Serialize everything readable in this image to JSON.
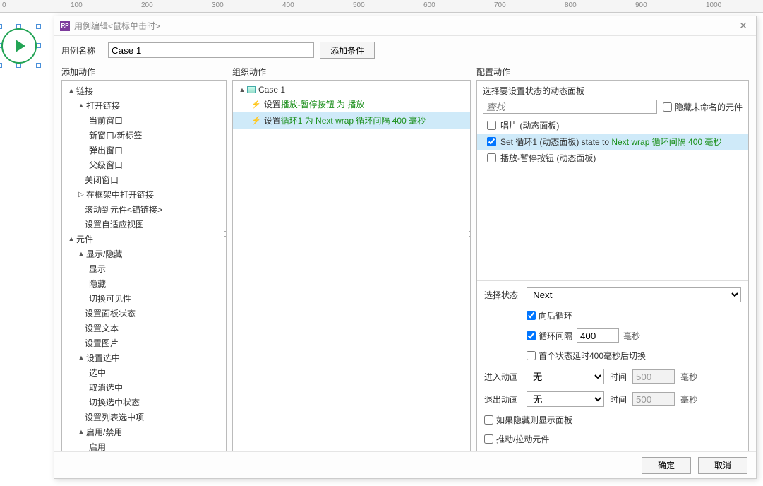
{
  "ruler": [
    "0",
    "100",
    "200",
    "300",
    "400",
    "500",
    "600",
    "700",
    "800",
    "900",
    "1000"
  ],
  "dialog": {
    "title": "用例编辑<鼠标单击时>",
    "icon_text": "RP",
    "close": "✕",
    "case_name_label": "用例名称",
    "case_name_value": "Case 1",
    "add_condition": "添加条件",
    "col1_label": "添加动作",
    "col2_label": "组织动作",
    "col3_label": "配置动作",
    "ok": "确定",
    "cancel": "取消"
  },
  "actions_tree": {
    "root1": "链接",
    "r1_1": "打开链接",
    "r1_1_1": "当前窗口",
    "r1_1_2": "新窗口/新标签",
    "r1_1_3": "弹出窗口",
    "r1_1_4": "父级窗口",
    "r1_2": "关闭窗口",
    "r1_3": "在框架中打开链接",
    "r1_4": "滚动到元件<锚链接>",
    "r1_5": "设置自适应视图",
    "root2": "元件",
    "r2_1": "显示/隐藏",
    "r2_1_1": "显示",
    "r2_1_2": "隐藏",
    "r2_1_3": "切换可见性",
    "r2_2": "设置面板状态",
    "r2_3": "设置文本",
    "r2_4": "设置图片",
    "r2_5": "设置选中",
    "r2_5_1": "选中",
    "r2_5_2": "取消选中",
    "r2_5_3": "切换选中状态",
    "r2_6": "设置列表选中项",
    "r2_7": "启用/禁用",
    "r2_7_1": "启用"
  },
  "organize": {
    "case": "Case 1",
    "a1_prefix": "设置 ",
    "a1_green": "播放-暂停按钮 为 播放",
    "a2_prefix": "设置 ",
    "a2_green": "循环1 为 Next wrap 循环间隔 400 毫秒"
  },
  "config": {
    "head": "选择要设置状态的动态面板",
    "search_placeholder": "查找",
    "hide_unnamed": "隐藏未命名的元件",
    "p1": "唱片 (动态面板)",
    "p2_a": "Set 循环1 (动态面板) state to ",
    "p2_b": "Next wrap 循环间隔 400 毫秒",
    "p3": "播放-暂停按钮 (动态面板)",
    "state_label": "选择状态",
    "state_value": "Next",
    "loop_back": "向后循环",
    "loop_interval": "循环间隔",
    "interval_val": "400",
    "ms": "毫秒",
    "first_delay": "首个状态延时400毫秒后切换",
    "anim_in": "进入动画",
    "anim_out": "退出动画",
    "anim_none": "无",
    "time_label": "时间",
    "time_val": "500",
    "show_if_hidden": "如果隐藏则显示面板",
    "push_pull": "推动/拉动元件"
  }
}
